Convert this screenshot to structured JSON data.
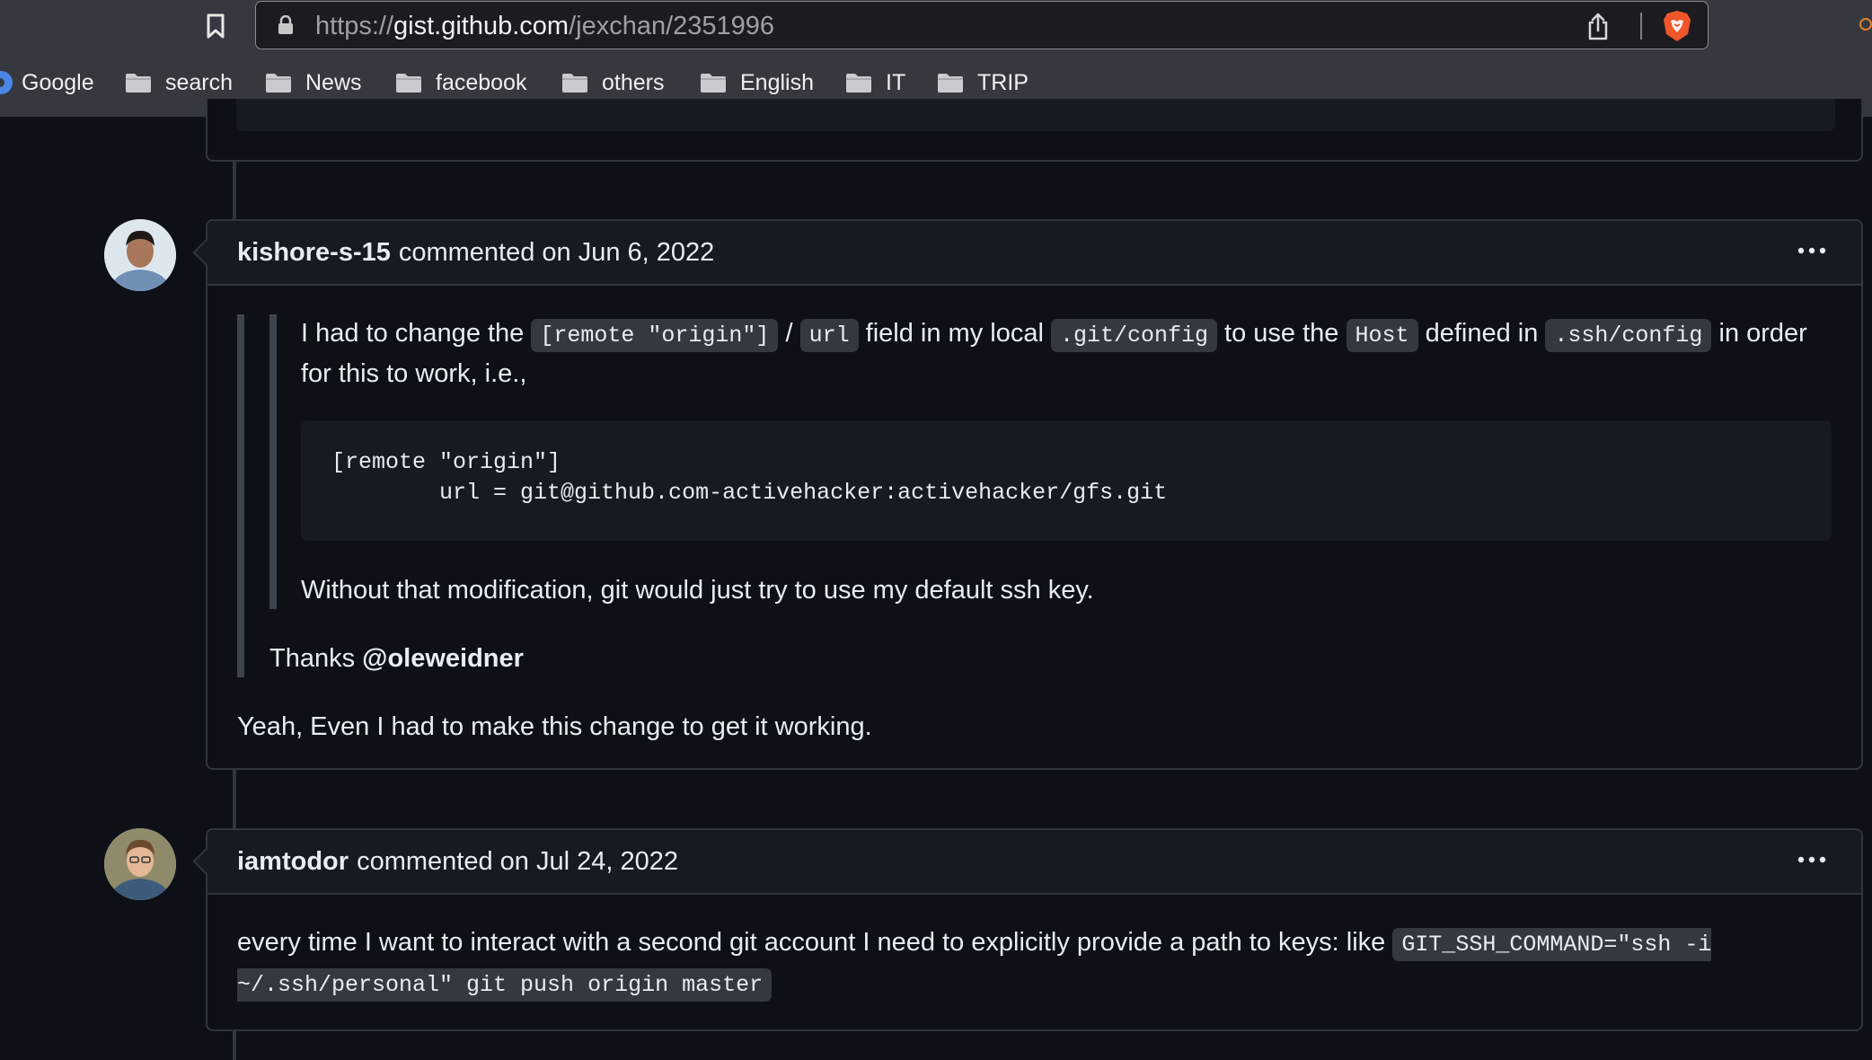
{
  "browser": {
    "url_prefix": "https://",
    "url_host": "gist.github.com",
    "url_path": "/jexchan/2351996",
    "bookmarks": [
      {
        "label": "Google",
        "icon": "google-icon"
      },
      {
        "label": "search",
        "icon": "folder-icon"
      },
      {
        "label": "News",
        "icon": "folder-icon"
      },
      {
        "label": "facebook",
        "icon": "folder-icon"
      },
      {
        "label": "others",
        "icon": "folder-icon"
      },
      {
        "label": "English",
        "icon": "folder-icon"
      },
      {
        "label": "IT",
        "icon": "folder-icon"
      },
      {
        "label": "TRIP",
        "icon": "folder-icon"
      }
    ]
  },
  "comments": [
    {
      "author": "kishore-s-15",
      "meta": "commented on Jun 6, 2022",
      "quote": {
        "t1": "I had to change the ",
        "c1": "[remote \"origin\"]",
        "t2": " / ",
        "c2": "url",
        "t3": " field in my local ",
        "c3": ".git/config",
        "t4": " to use the ",
        "c4": "Host",
        "t5": " defined in ",
        "c5": ".ssh/config",
        "t6": " in order for this to work, i.e.,",
        "code": "[remote \"origin\"]\n        url = git@github.com-activehacker:activehacker/gfs.git",
        "after": "Without that modification, git would just try to use my default ssh key."
      },
      "thanks_text": "Thanks ",
      "thanks_mention": "@oleweidner",
      "body": "Yeah, Even I had to make this change to get it working."
    },
    {
      "author": "iamtodor",
      "meta": "commented on Jul 24, 2022",
      "body_text": "every time I want to interact with a second git account I need to explicitly provide a path to keys: like ",
      "body_code": "GIT_SSH_COMMAND=\"ssh -i ~/.ssh/personal\" git push origin master"
    }
  ],
  "colors": {
    "page_bg": "#0d1117",
    "header_bg": "#161b22",
    "border": "#30363d",
    "chrome_bg": "#363840"
  }
}
